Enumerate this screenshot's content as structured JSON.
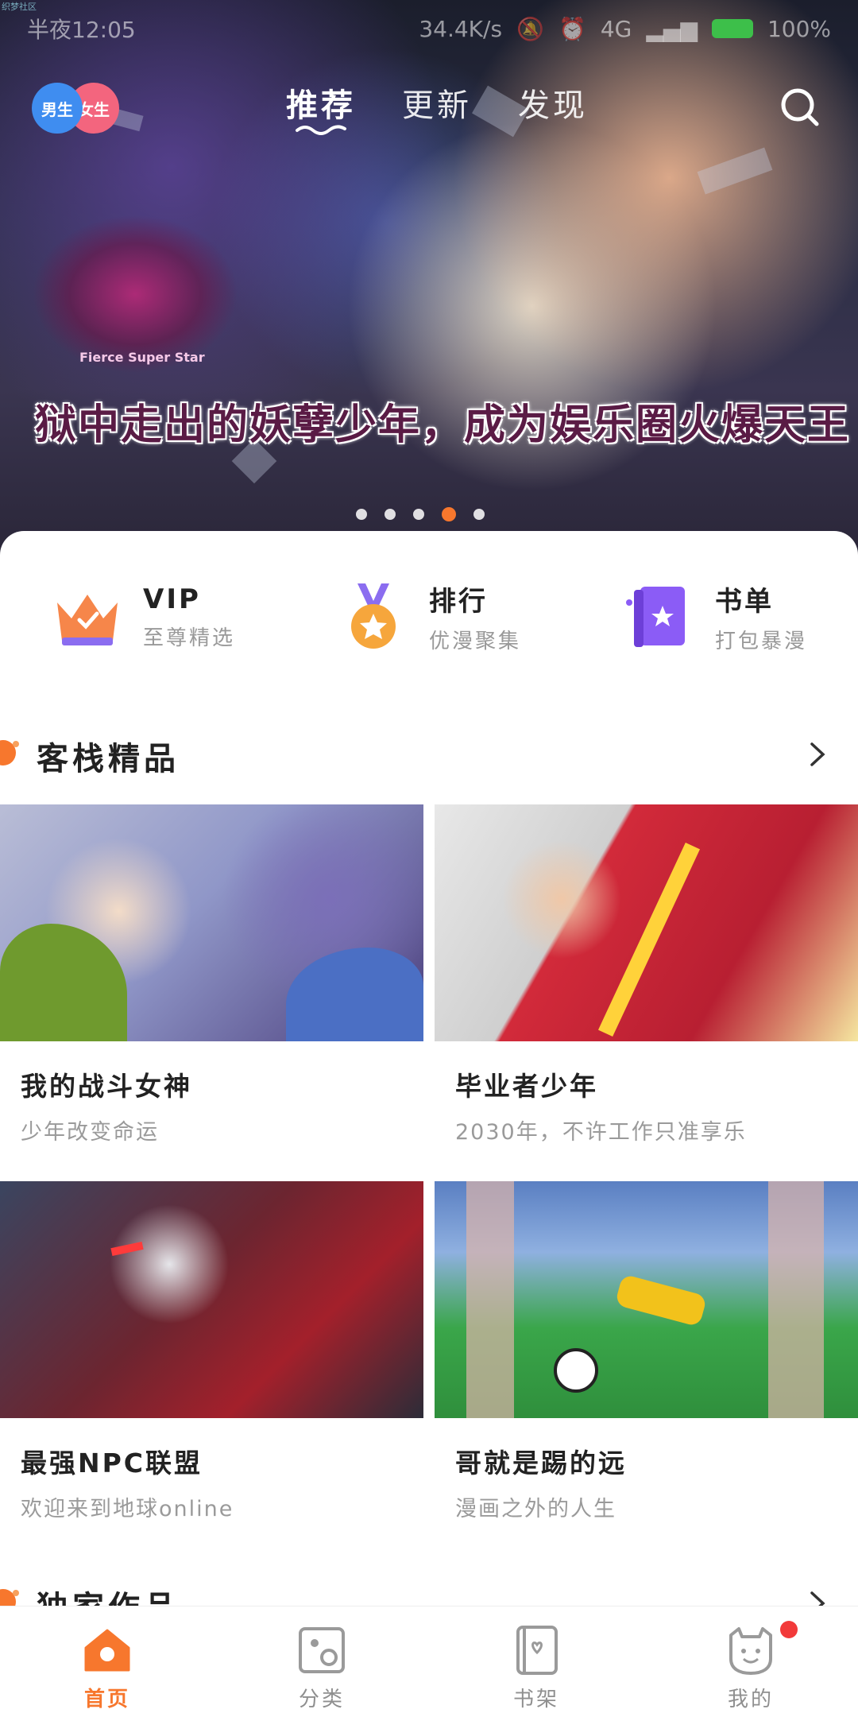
{
  "status_bar": {
    "corner_tag": "织梦社区",
    "carrier_time": "半夜12:05",
    "speed": "34.4K/s",
    "network": "4G",
    "battery": "100%"
  },
  "header": {
    "gender_boy": "男生",
    "gender_girl": "女生",
    "tabs": [
      {
        "label": "推荐",
        "active": true
      },
      {
        "label": "更新",
        "active": false
      },
      {
        "label": "发现",
        "active": false
      }
    ],
    "search_icon": "search-icon"
  },
  "banner": {
    "caption": "狱中走出的妖孽少年，成为娱乐圈火爆天王",
    "logo_text": "Fierce Super Star",
    "dots": 5,
    "active_dot": 4
  },
  "quick_entries": [
    {
      "title": "VIP",
      "subtitle": "至尊精选",
      "icon": "crown-icon"
    },
    {
      "title": "排行",
      "subtitle": "优漫聚集",
      "icon": "medal-icon"
    },
    {
      "title": "书单",
      "subtitle": "打包暴漫",
      "icon": "book-icon"
    }
  ],
  "sections": [
    {
      "title": "客栈精品",
      "cards": [
        {
          "name": "我的战斗女神",
          "desc": "少年改变命运"
        },
        {
          "name": "毕业者少年",
          "desc": "2030年，不许工作只准享乐"
        },
        {
          "name": "最强NPC联盟",
          "desc": "欢迎来到地球online"
        },
        {
          "name": "哥就是踢的远",
          "desc": "漫画之外的人生"
        }
      ]
    },
    {
      "title": "独家作品",
      "cards": []
    }
  ],
  "bottom_nav": [
    {
      "label": "首页",
      "icon": "home-icon",
      "active": true
    },
    {
      "label": "分类",
      "icon": "category-icon",
      "active": false
    },
    {
      "label": "书架",
      "icon": "bookshelf-icon",
      "active": false
    },
    {
      "label": "我的",
      "icon": "profile-icon",
      "active": false,
      "badge": true
    }
  ],
  "colors": {
    "accent": "#f7772d",
    "badge": "#f23a3a",
    "boy": "#3f8df0",
    "girl": "#f3657e"
  }
}
